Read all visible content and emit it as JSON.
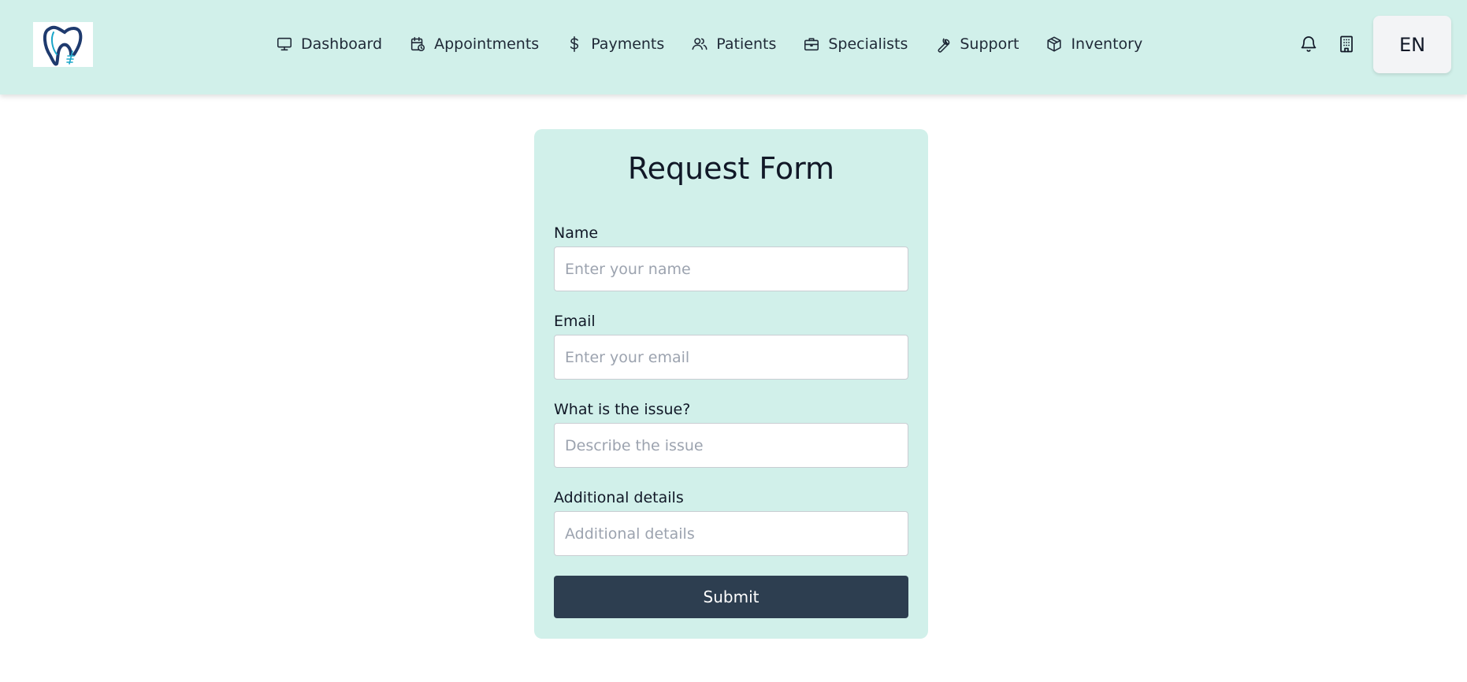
{
  "header": {
    "logo_icon": "tooth-logo-icon",
    "nav": [
      {
        "label": "Dashboard",
        "icon": "monitor-icon"
      },
      {
        "label": "Appointments",
        "icon": "calendar-clock-icon"
      },
      {
        "label": "Payments",
        "icon": "dollar-icon"
      },
      {
        "label": "Patients",
        "icon": "users-icon"
      },
      {
        "label": "Specialists",
        "icon": "briefcase-icon"
      },
      {
        "label": "Support",
        "icon": "wrench-icon"
      },
      {
        "label": "Inventory",
        "icon": "box-icon"
      }
    ],
    "notification_icon": "bell-icon",
    "building_icon": "building-icon",
    "language": "EN"
  },
  "form": {
    "title": "Request Form",
    "fields": [
      {
        "label": "Name",
        "placeholder": "Enter your name",
        "value": ""
      },
      {
        "label": "Email",
        "placeholder": "Enter your email",
        "value": ""
      },
      {
        "label": "What is the issue?",
        "placeholder": "Describe the issue",
        "value": ""
      },
      {
        "label": "Additional details",
        "placeholder": "Additional details",
        "value": ""
      }
    ],
    "submit_label": "Submit"
  },
  "colors": {
    "header_bg": "#d1f0ea",
    "card_bg": "#d1f0ea",
    "submit_bg": "#2d3e50",
    "logo_dark": "#1e3a6e",
    "logo_accent": "#1aa6c9"
  }
}
